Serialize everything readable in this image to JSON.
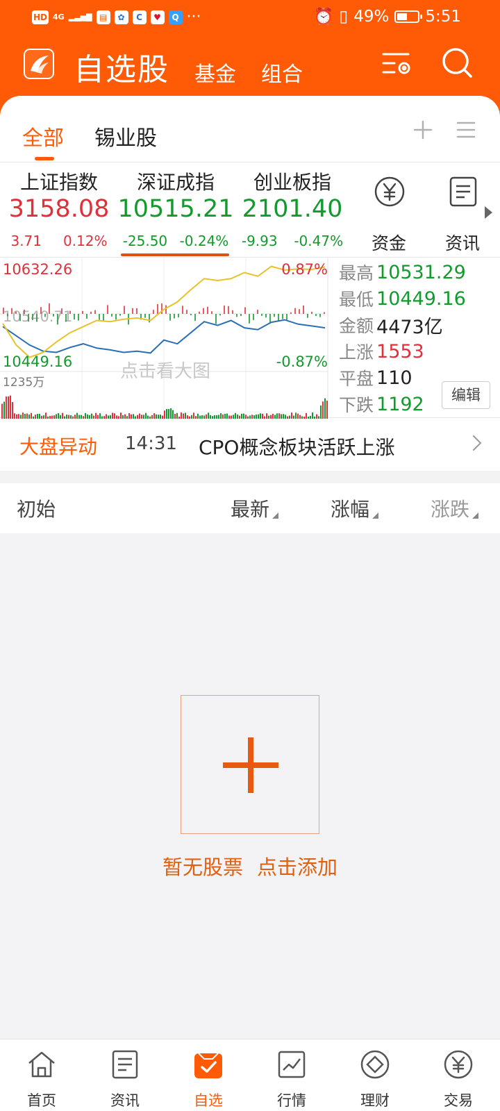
{
  "status_bar": {
    "left_badges": [
      "HD",
      "4G"
    ],
    "battery": "49%",
    "time": "5:51",
    "more": "···",
    "battery_level": 0.49
  },
  "app_bar": {
    "title": "自选股",
    "tabs": [
      "基金",
      "组合"
    ],
    "icons": [
      "list-settings-icon",
      "search-icon"
    ]
  },
  "tabs": {
    "items": [
      "全部",
      "锡业股"
    ],
    "active_index": 0,
    "icons": [
      "plus-icon",
      "menu-icon"
    ]
  },
  "indices": [
    {
      "name": "上证指数",
      "value": "3158.08",
      "change": "3.71",
      "percent": "0.12%",
      "trend": "up"
    },
    {
      "name": "深证成指",
      "value": "10515.21",
      "change": "-25.50",
      "percent": "-0.24%",
      "trend": "down"
    },
    {
      "name": "创业板指",
      "value": "2101.40",
      "change": "-9.93",
      "percent": "-0.47%",
      "trend": "down"
    }
  ],
  "side_buttons": [
    {
      "label": "资金",
      "icon": "yuan-circle-icon"
    },
    {
      "label": "资讯",
      "icon": "document-icon"
    }
  ],
  "chart": {
    "high_label": "10632.26",
    "mid_label": "10540.71",
    "low_label": "10449.16",
    "up_pct": "0.87%",
    "down_pct": "-0.87%",
    "volume_label": "1235万",
    "watermark": "点击看大图"
  },
  "chart_data": {
    "type": "line",
    "ylim": [
      10449.16,
      10632.26
    ],
    "series": [
      {
        "color": "#2a6fb5",
        "values": [
          10520,
          10505,
          10490,
          10480,
          10478,
          10486,
          10492,
          10485,
          10482,
          10478,
          10480,
          10477,
          10498,
          10492,
          10510,
          10528,
          10522,
          10530,
          10518,
          10515,
          10527,
          10531,
          10524,
          10521,
          10518
        ]
      },
      {
        "color": "#e8c22a",
        "values": [
          10525,
          10490,
          10470,
          10478,
          10495,
          10510,
          10520,
          10530,
          10528,
          10532,
          10534,
          10530,
          10548,
          10560,
          10580,
          10598,
          10595,
          10598,
          10608,
          10602,
          10618,
          10612,
          10614,
          10613,
          10617
        ]
      }
    ]
  },
  "market_stats": [
    {
      "label": "最高",
      "value": "10531.29",
      "trend": "down"
    },
    {
      "label": "最低",
      "value": "10449.16",
      "trend": "down"
    },
    {
      "label": "金额",
      "value": "4473亿",
      "trend": "neutral"
    },
    {
      "label": "上涨",
      "value": "1553",
      "trend": "up"
    },
    {
      "label": "平盘",
      "value": "110",
      "trend": "neutral"
    },
    {
      "label": "下跌",
      "value": "1192",
      "trend": "down"
    }
  ],
  "edit_label": "编辑",
  "ticker": {
    "title": "大盘异动",
    "time": "14:31",
    "text": "CPO概念板块活跃上涨"
  },
  "list_header": {
    "init": "初始",
    "latest": "最新",
    "pct": "涨幅",
    "change": "涨跌"
  },
  "empty_state": {
    "line1": "暂无股票",
    "line2": "点击添加"
  },
  "bottom_nav": [
    {
      "label": "首页",
      "icon": "home-icon"
    },
    {
      "label": "资讯",
      "icon": "news-icon"
    },
    {
      "label": "自选",
      "icon": "watchlist-icon"
    },
    {
      "label": "行情",
      "icon": "market-chart-icon"
    },
    {
      "label": "理财",
      "icon": "diamond-icon"
    },
    {
      "label": "交易",
      "icon": "yuan-circle-icon"
    }
  ],
  "colors": {
    "brand": "#ff5a05",
    "up": "#e1303a",
    "down": "#129a2d"
  }
}
